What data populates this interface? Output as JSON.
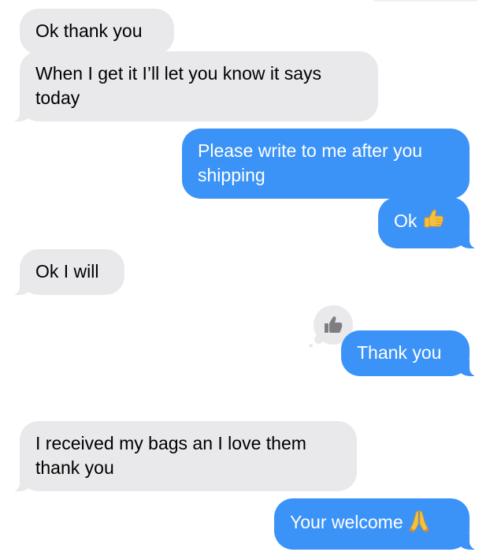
{
  "messages": [
    {
      "direction": "incoming",
      "text": "Ok thank you"
    },
    {
      "direction": "incoming",
      "text": "When I get it I’ll let you know it says today"
    },
    {
      "direction": "outgoing",
      "text": "Please write to me after you shipping"
    },
    {
      "direction": "outgoing",
      "text": "Ok",
      "emoji": "thumbs-up-emoji"
    },
    {
      "direction": "incoming",
      "text": "Ok I will"
    },
    {
      "direction": "outgoing",
      "text": "Thank you",
      "reaction": "thumbs-up-icon"
    },
    {
      "direction": "incoming",
      "text": "I received my bags an I love them thank you"
    },
    {
      "direction": "outgoing",
      "text": "Your welcome",
      "emoji": "folded-hands-emoji"
    }
  ],
  "colors": {
    "incoming_bubble": "#e9e9eb",
    "outgoing_bubble": "#3b93f7",
    "outgoing_text": "#ffffff",
    "incoming_text": "#000000"
  }
}
